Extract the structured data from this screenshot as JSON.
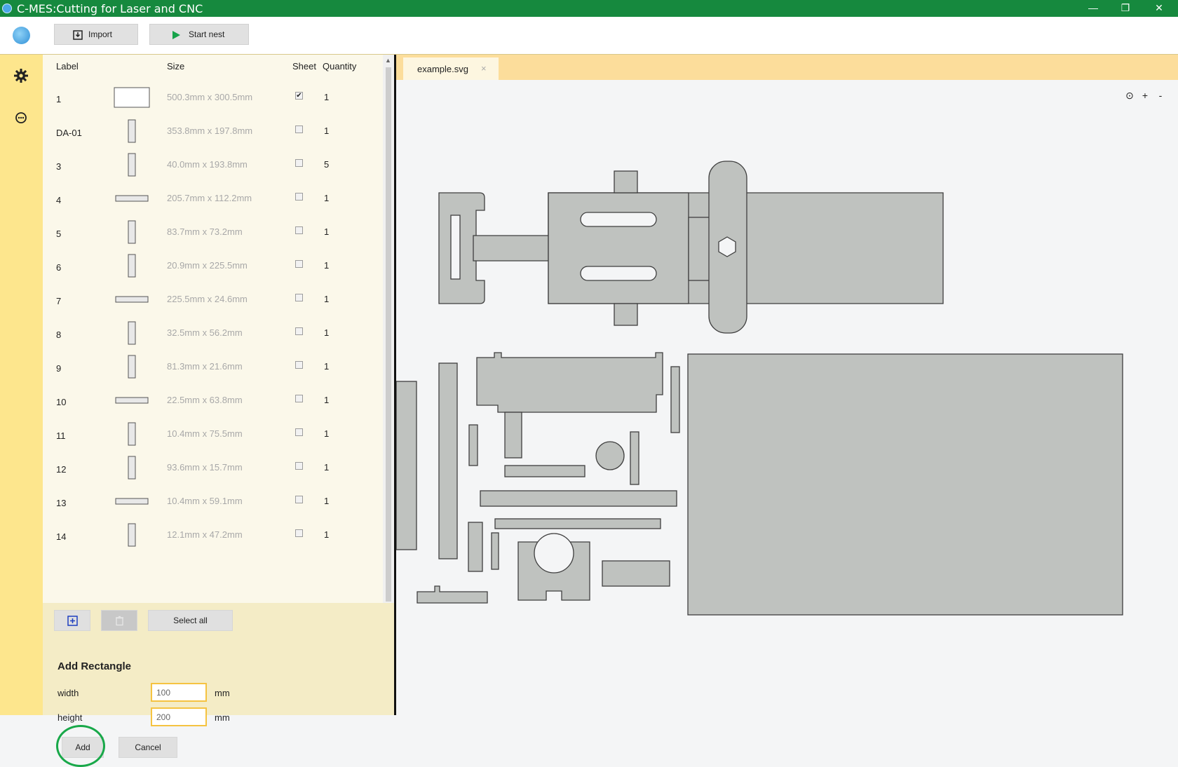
{
  "window": {
    "title": "C-MES:Cutting for Laser and CNC",
    "minimize": "—",
    "maximize": "❐",
    "close": "✕"
  },
  "toolbar": {
    "import_label": "Import",
    "start_nest_label": "Start nest"
  },
  "parts_table": {
    "headers": {
      "label": "Label",
      "size": "Size",
      "sheet": "Sheet",
      "quantity": "Quantity"
    },
    "rows": [
      {
        "label": "1",
        "size": "500.3mm x 300.5mm",
        "sheet": true,
        "quantity": "1"
      },
      {
        "label": "DA-01",
        "size": "353.8mm x 197.8mm",
        "sheet": false,
        "quantity": "1"
      },
      {
        "label": "3",
        "size": "40.0mm x 193.8mm",
        "sheet": false,
        "quantity": "5"
      },
      {
        "label": "4",
        "size": "205.7mm x 112.2mm",
        "sheet": false,
        "quantity": "1"
      },
      {
        "label": "5",
        "size": "83.7mm x 73.2mm",
        "sheet": false,
        "quantity": "1"
      },
      {
        "label": "6",
        "size": "20.9mm x 225.5mm",
        "sheet": false,
        "quantity": "1"
      },
      {
        "label": "7",
        "size": "225.5mm x 24.6mm",
        "sheet": false,
        "quantity": "1"
      },
      {
        "label": "8",
        "size": "32.5mm x 56.2mm",
        "sheet": false,
        "quantity": "1"
      },
      {
        "label": "9",
        "size": "81.3mm x 21.6mm",
        "sheet": false,
        "quantity": "1"
      },
      {
        "label": "10",
        "size": "22.5mm x 63.8mm",
        "sheet": false,
        "quantity": "1"
      },
      {
        "label": "11",
        "size": "10.4mm x 75.5mm",
        "sheet": false,
        "quantity": "1"
      },
      {
        "label": "12",
        "size": "93.6mm x 15.7mm",
        "sheet": false,
        "quantity": "1"
      },
      {
        "label": "13",
        "size": "10.4mm x 59.1mm",
        "sheet": false,
        "quantity": "1"
      },
      {
        "label": "14",
        "size": "12.1mm x 47.2mm",
        "sheet": false,
        "quantity": "1"
      }
    ]
  },
  "parts_actions": {
    "select_all_label": "Select all"
  },
  "add_rectangle": {
    "title": "Add Rectangle",
    "width_label": "width",
    "width_value": "100",
    "height_label": "height",
    "height_value": "200",
    "unit": "mm",
    "add_label": "Add",
    "cancel_label": "Cancel"
  },
  "canvas": {
    "tab_name": "example.svg",
    "tab_close": "×",
    "zoom_reset": "⊙",
    "zoom_in": "+",
    "zoom_out": "-"
  },
  "colors": {
    "titlebar": "#16893e",
    "sidebar": "#fde68d",
    "tabbar": "#fcdd9b",
    "part_fill": "#bfc2bf",
    "highlight": "#18a849",
    "input_border": "#f5c341"
  }
}
